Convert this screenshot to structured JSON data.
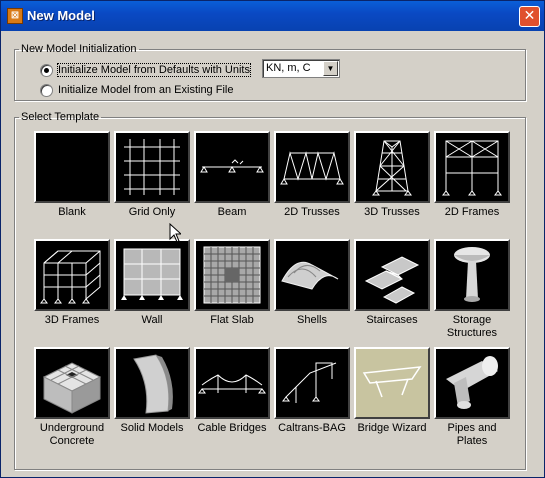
{
  "window": {
    "title": "New Model",
    "icon": "sap-logo-icon",
    "close_icon": "close-icon"
  },
  "init_group": {
    "legend": "New Model Initialization",
    "option_defaults": "Initialize Model from Defaults with Units",
    "option_existing": "Initialize Model  from an Existing File",
    "selected": "defaults",
    "units": "KN, m, C"
  },
  "template_group": {
    "legend": "Select Template",
    "templates": [
      {
        "label": "Blank",
        "icon": "blank-icon"
      },
      {
        "label": "Grid Only",
        "icon": "grid-icon"
      },
      {
        "label": "Beam",
        "icon": "beam-icon"
      },
      {
        "label": "2D Trusses",
        "icon": "2d-truss-icon"
      },
      {
        "label": "3D Trusses",
        "icon": "3d-truss-icon"
      },
      {
        "label": "2D Frames",
        "icon": "2d-frame-icon"
      },
      {
        "label": "3D Frames",
        "icon": "3d-frame-icon"
      },
      {
        "label": "Wall",
        "icon": "wall-icon"
      },
      {
        "label": "Flat Slab",
        "icon": "flat-slab-icon"
      },
      {
        "label": "Shells",
        "icon": "shells-icon"
      },
      {
        "label": "Staircases",
        "icon": "staircase-icon"
      },
      {
        "label": "Storage Structures",
        "icon": "storage-structure-icon"
      },
      {
        "label": "Underground Concrete",
        "icon": "underground-concrete-icon"
      },
      {
        "label": "Solid Models",
        "icon": "solid-model-icon"
      },
      {
        "label": "Cable Bridges",
        "icon": "cable-bridge-icon"
      },
      {
        "label": "Caltrans-BAG",
        "icon": "caltrans-bag-icon"
      },
      {
        "label": "Bridge Wizard",
        "icon": "bridge-wizard-icon"
      },
      {
        "label": "Pipes and Plates",
        "icon": "pipes-plates-icon"
      }
    ]
  }
}
